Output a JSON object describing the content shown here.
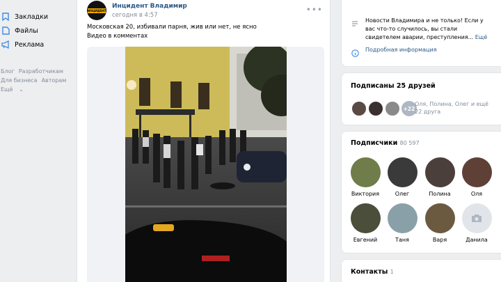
{
  "sidebar": {
    "items": [
      {
        "label": "Закладки",
        "icon": "bookmark-icon"
      },
      {
        "label": "Файлы",
        "icon": "file-icon"
      },
      {
        "label": "Реклама",
        "icon": "megaphone-icon"
      }
    ],
    "links": [
      "Блог",
      "Разработчикам",
      "Для бизнеса",
      "Авторам",
      "Ещё"
    ]
  },
  "post": {
    "author": "Инцидент Владимир",
    "avatar_text": "ИНЦИДЕНТ",
    "time": "сегодня в 4:57",
    "text_line1": "Московская 20, избивали парня, жив или нет, не ясно",
    "text_line2": "Видео в комментах"
  },
  "info": {
    "description": "Новости Владимира и не только! Если у вас что-то случилось, вы стали свидетелем аварии, преступления...",
    "more": "Ещё",
    "details_link": "Подробная информация"
  },
  "friends": {
    "title": "Подписаны 25 друзей",
    "more_count": "+22",
    "names": "Оля, Полина, Олег и ещё 22 друга"
  },
  "subscribers": {
    "title": "Подписчики",
    "count": "80 597",
    "people": [
      {
        "name": "Виктория"
      },
      {
        "name": "Олег"
      },
      {
        "name": "Полина"
      },
      {
        "name": "Оля"
      },
      {
        "name": "Евгений"
      },
      {
        "name": "Таня"
      },
      {
        "name": "Варя"
      },
      {
        "name": "Данила"
      }
    ]
  },
  "contacts": {
    "title": "Контакты",
    "count": "1"
  },
  "colors": {
    "link": "#2a5885",
    "muted": "#818c99",
    "background": "#edeef0"
  }
}
